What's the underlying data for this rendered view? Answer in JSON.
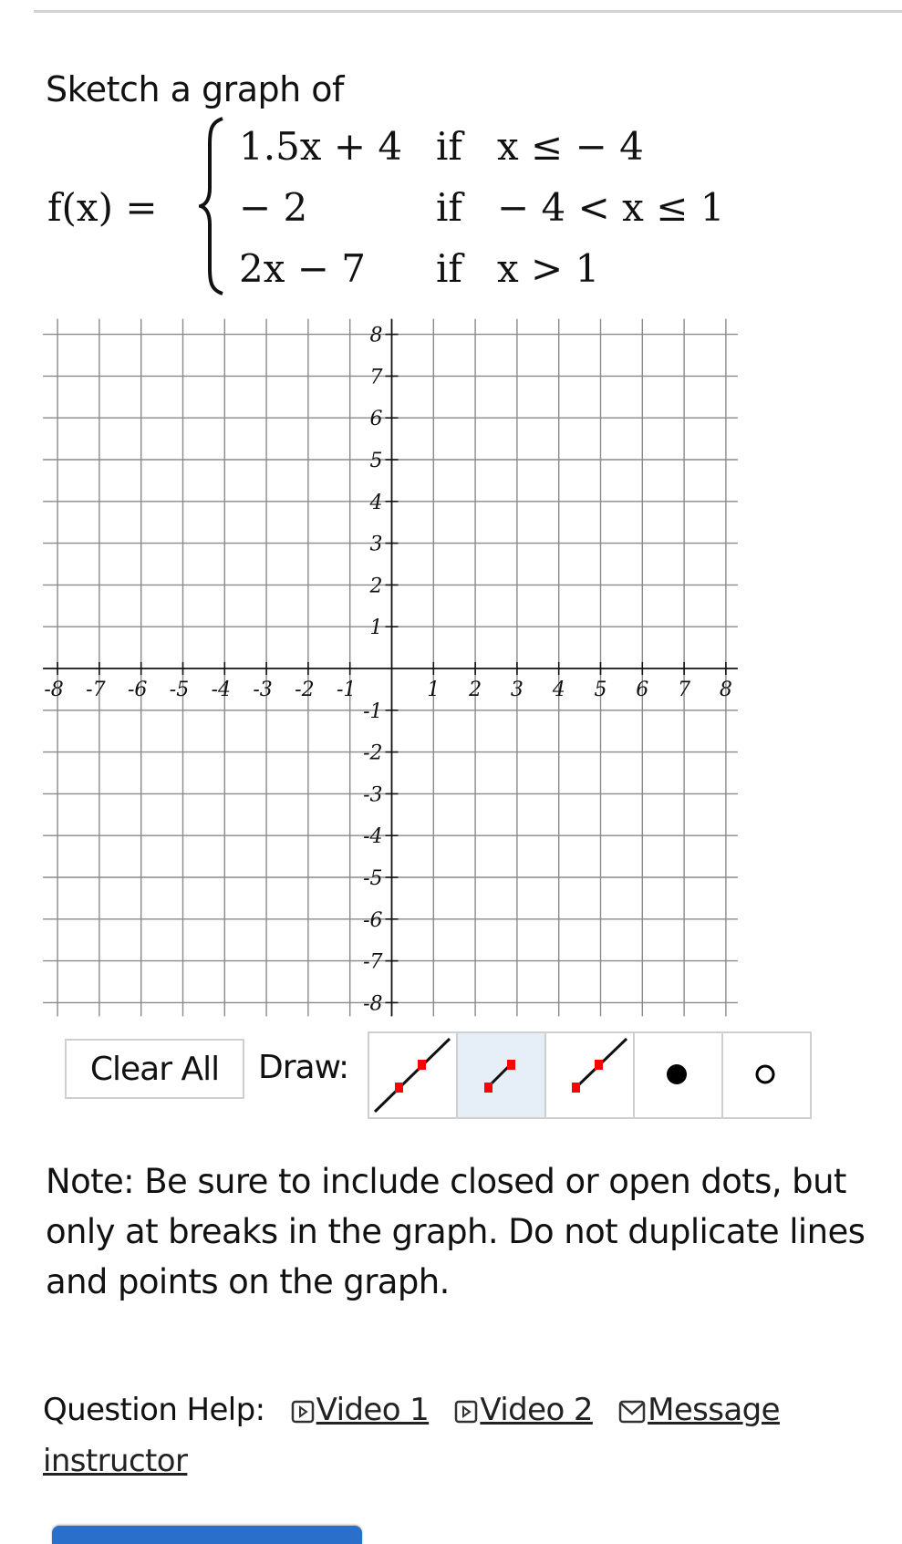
{
  "question": {
    "prompt": "Sketch a graph of",
    "function_name": "f(x) =",
    "pieces": [
      {
        "expression": "1.5x + 4",
        "if_label": "if",
        "condition": "x ≤ − 4"
      },
      {
        "expression": "− 2",
        "if_label": "if",
        "condition": "− 4 < x ≤ 1"
      },
      {
        "expression": "2x − 7",
        "if_label": "if",
        "condition": "x > 1"
      }
    ]
  },
  "chart_data": {
    "type": "scatter",
    "title": "",
    "xlabel": "",
    "ylabel": "",
    "xlim": [
      -8,
      8
    ],
    "ylim": [
      -8,
      8
    ],
    "grid": true,
    "x_ticks": [
      "-8",
      "-7",
      "-6",
      "-5",
      "-4",
      "-3",
      "-2",
      "-1",
      "1",
      "2",
      "3",
      "4",
      "5",
      "6",
      "7",
      "8"
    ],
    "y_ticks": [
      "8",
      "7",
      "6",
      "5",
      "4",
      "3",
      "2",
      "1",
      "-1",
      "-2",
      "-3",
      "-4",
      "-5",
      "-6",
      "-7",
      "-8"
    ],
    "series": []
  },
  "toolbar": {
    "clear_all_label": "Clear All",
    "draw_label": "Draw:",
    "tools": [
      {
        "name": "line",
        "icon": "line-tool-icon",
        "selected": false
      },
      {
        "name": "segment",
        "icon": "segment-tool-icon",
        "selected": true
      },
      {
        "name": "ray",
        "icon": "ray-tool-icon",
        "selected": false
      },
      {
        "name": "closed-dot",
        "icon": "closed-dot-icon",
        "selected": false
      },
      {
        "name": "open-dot",
        "icon": "open-dot-icon",
        "selected": false
      }
    ],
    "accent_color": "#e6eff8",
    "handle_color": "#ff0000"
  },
  "note": "Note: Be sure to include closed or open dots, but only at breaks in the graph. Do not duplicate lines and points on the graph.",
  "help": {
    "label": "Question Help:",
    "links": [
      {
        "label": "Video 1",
        "icon": "video-icon"
      },
      {
        "label": "Video 2",
        "icon": "video-icon"
      },
      {
        "label": "Message instructor",
        "icon": "mail-icon"
      }
    ]
  }
}
